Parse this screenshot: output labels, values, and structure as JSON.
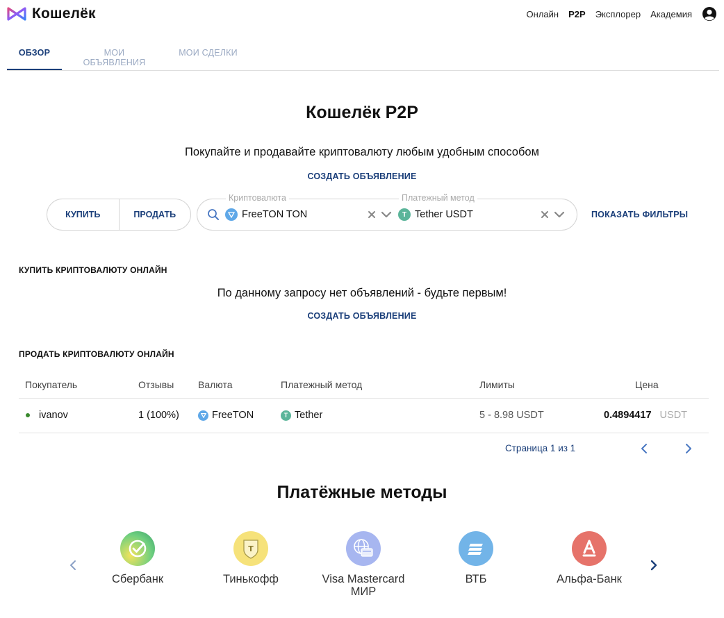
{
  "header": {
    "logo_text": "Кошелёк",
    "nav": [
      {
        "label": "Онлайн",
        "active": false
      },
      {
        "label": "P2P",
        "active": true
      },
      {
        "label": "Эксплорер",
        "active": false
      },
      {
        "label": "Академия",
        "active": false
      }
    ]
  },
  "tabs": [
    {
      "label": "ОБЗОР",
      "active": true
    },
    {
      "label": "МОИ ОБЪЯВЛЕНИЯ",
      "active": false
    },
    {
      "label": "МОИ СДЕЛКИ",
      "active": false
    }
  ],
  "hero": {
    "title": "Кошелёк P2P",
    "subtitle": "Покупайте и продавайте криптовалюту любым удобным способом",
    "create_label": "СОЗДАТЬ ОБЪЯВЛЕНИЕ"
  },
  "filters": {
    "buy_label": "КУПИТЬ",
    "sell_label": "ПРОДАТЬ",
    "crypto_label": "Криптовалюта",
    "crypto_value": "FreeTON TON",
    "payment_label": "Платежный метод",
    "payment_value": "Tether USDT",
    "show_filters_label": "ПОКАЗАТЬ ФИЛЬТРЫ"
  },
  "buy_section": {
    "title": "КУПИТЬ КРИПТОВАЛЮТУ ОНЛАЙН",
    "empty_message": "По данному запросу нет объявлений - будьте первым!",
    "create_label": "СОЗДАТЬ ОБЪЯВЛЕНИЕ"
  },
  "sell_section": {
    "title": "ПРОДАТЬ КРИПТОВАЛЮТУ ОНЛАЙН",
    "columns": [
      "Покупатель",
      "Отзывы",
      "Валюта",
      "Платежный метод",
      "Лимиты",
      "Цена"
    ],
    "rows": [
      {
        "buyer": "ivanov",
        "reviews": "1 (100%)",
        "currency": "FreeTON",
        "payment": "Tether",
        "limits": "5 - 8.98 USDT",
        "price": "0.4894417",
        "price_unit": "USDT"
      }
    ],
    "pager_text": "Страница 1 из 1"
  },
  "payment_methods": {
    "title": "Платёжные методы",
    "items": [
      {
        "name": "Сбербанк",
        "icon": "sberbank-icon"
      },
      {
        "name": "Тинькофф",
        "icon": "tinkoff-icon"
      },
      {
        "name": "Visa Mastercard МИР",
        "icon": "card-globe-icon"
      },
      {
        "name": "ВТБ",
        "icon": "vtb-icon"
      },
      {
        "name": "Альфа-Банк",
        "icon": "alfa-bank-icon"
      }
    ]
  },
  "colors": {
    "accent": "#1b3f7a",
    "tab_inactive": "#9aa9c2",
    "online_dot": "#3a8a2e"
  }
}
